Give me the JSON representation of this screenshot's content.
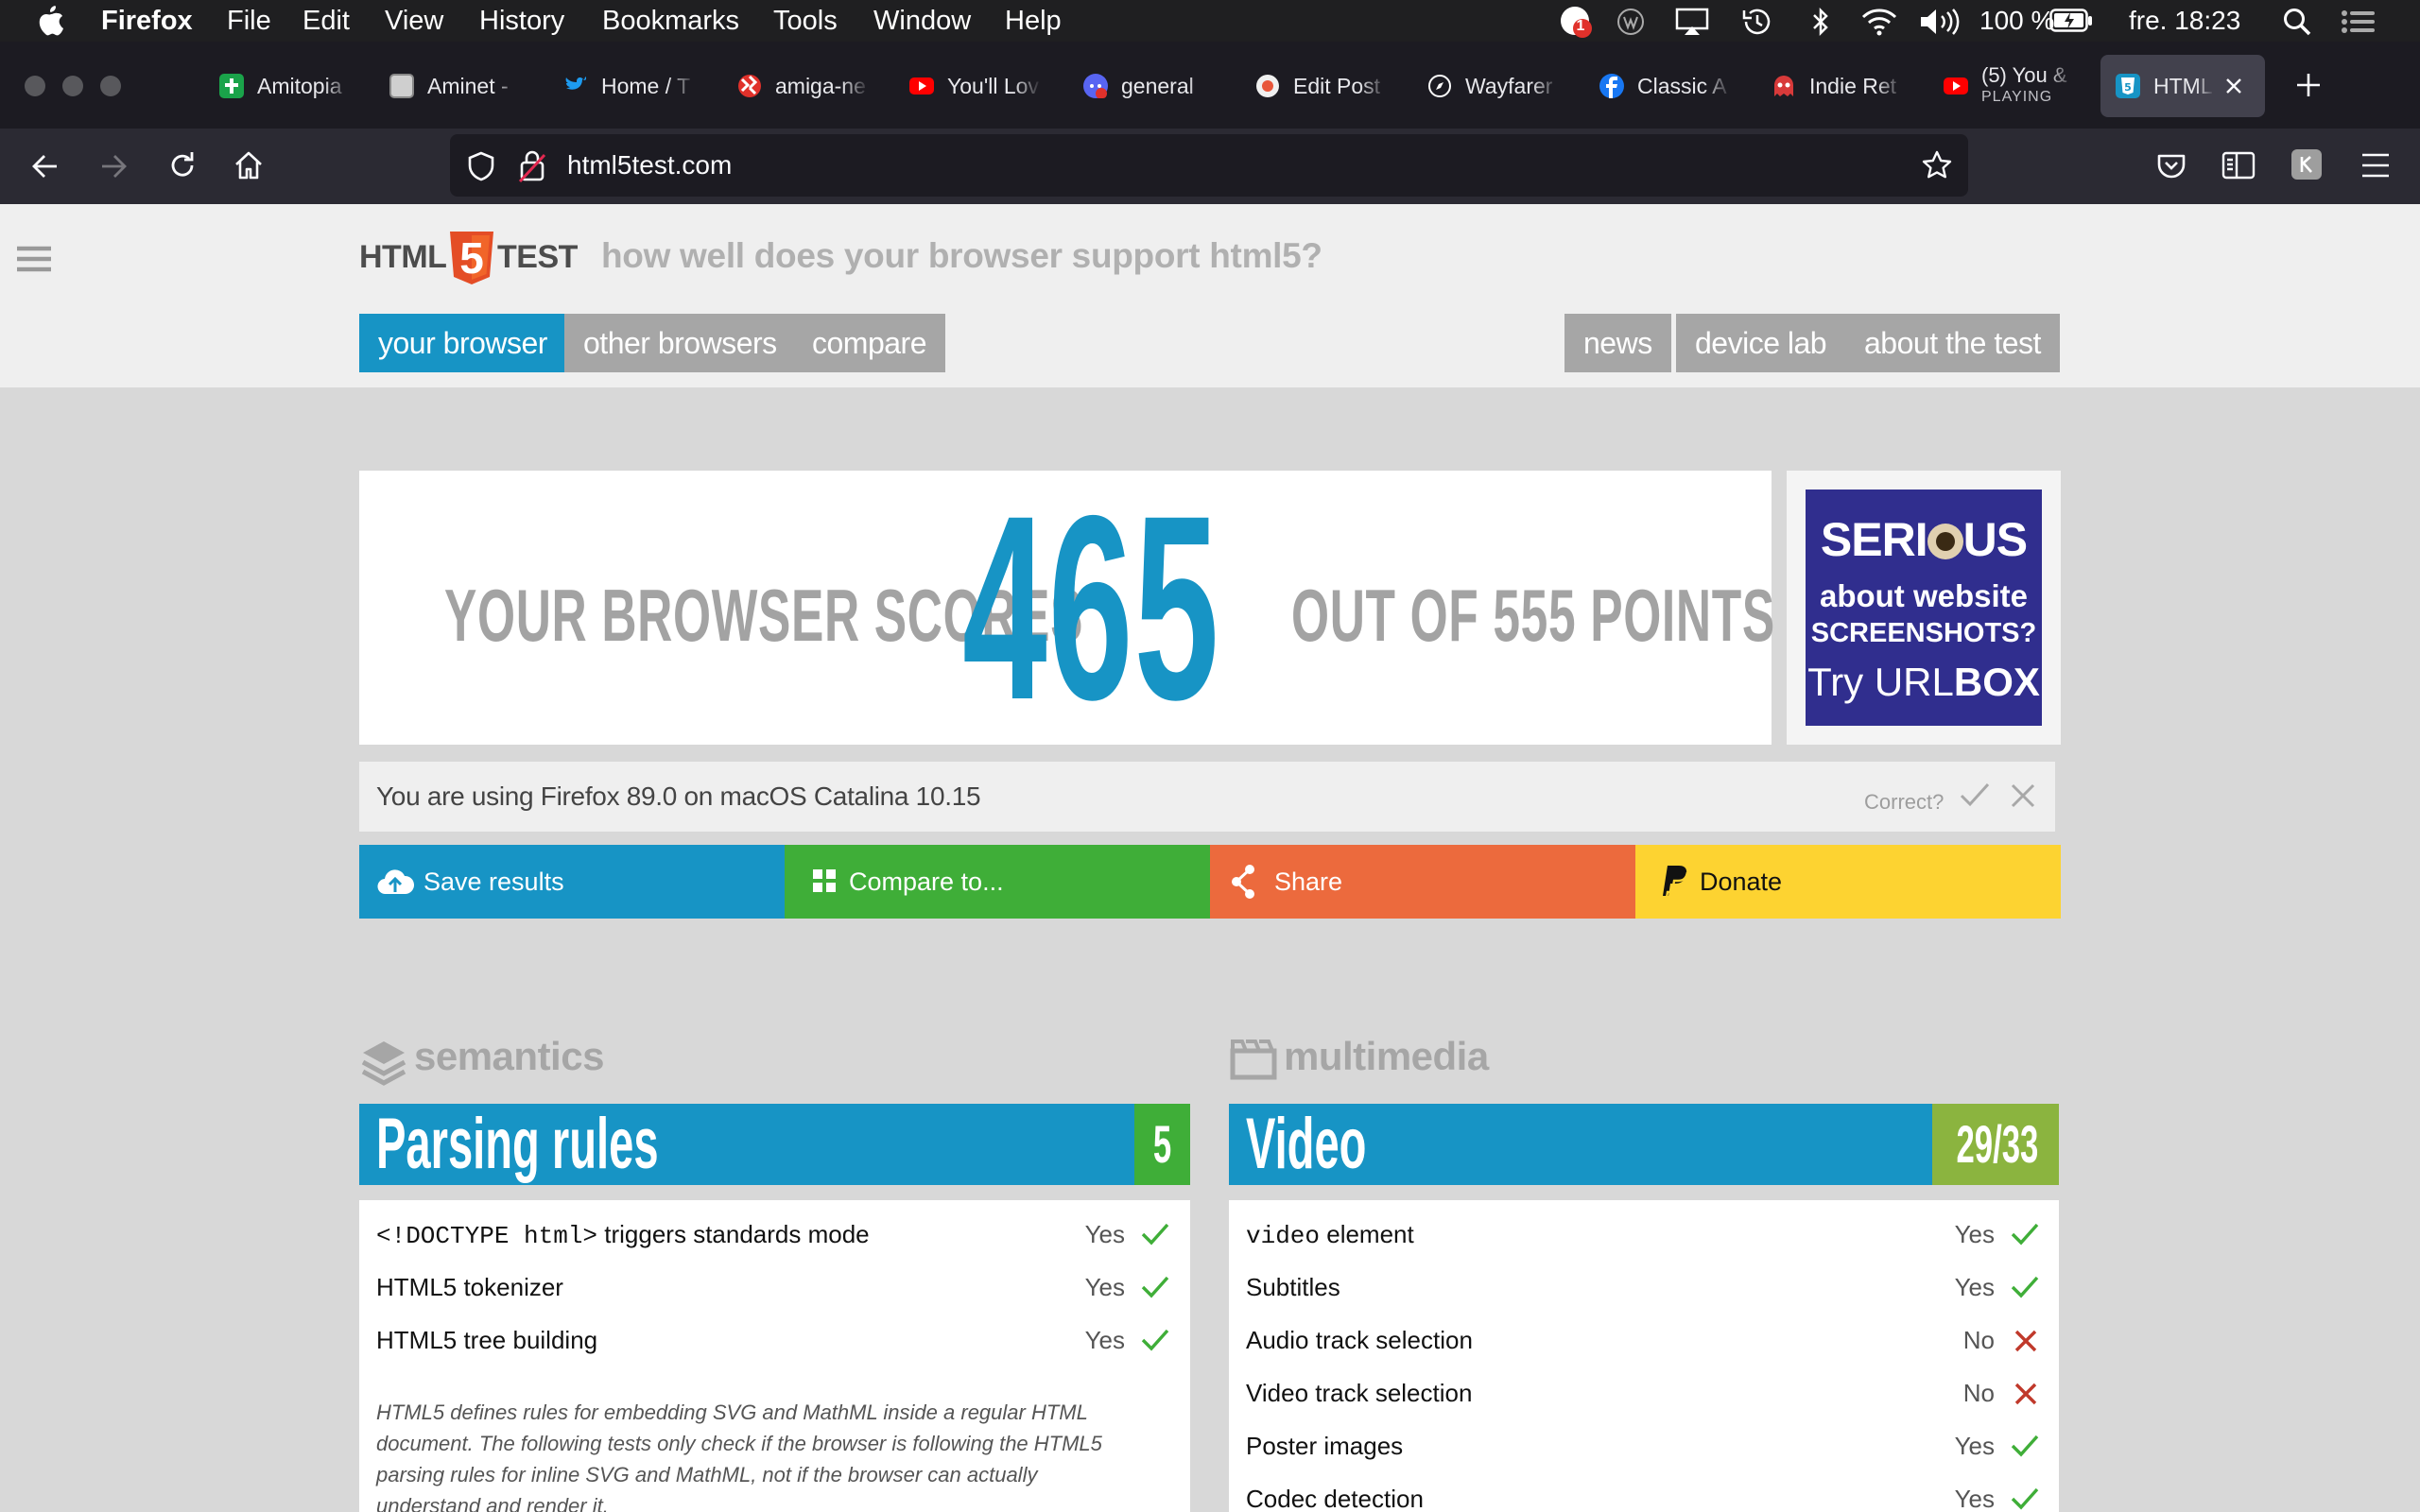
{
  "menubar": {
    "app": "Firefox",
    "items": [
      "File",
      "Edit",
      "View",
      "History",
      "Bookmarks",
      "Tools",
      "Window",
      "Help"
    ],
    "badge": "1",
    "battery": "100 %",
    "clock": "fre. 18:23"
  },
  "tabs": [
    {
      "label": "Amitopia",
      "color": "#1aa34a"
    },
    {
      "label": "Aminet -",
      "color": "#dddddd"
    },
    {
      "label": "Home / T",
      "color": "#1d9bf0"
    },
    {
      "label": "amiga-ne",
      "color": "#e0312b"
    },
    {
      "label": "You'll Lov",
      "color": "#ff0000"
    },
    {
      "label": "general",
      "color": "#5865f2"
    },
    {
      "label": "Edit Post",
      "color": "#f0f0f0"
    },
    {
      "label": "Wayfarer",
      "color": "#ffffff"
    },
    {
      "label": "Classic A",
      "color": "#1877f2"
    },
    {
      "label": "Indie Ret",
      "color": "#d83a3a"
    },
    {
      "label": "(5) You &",
      "sub": "PLAYING",
      "color": "#ff0000"
    },
    {
      "label": "HTML5",
      "color": "#1794c5"
    }
  ],
  "urlbar": {
    "url": "html5test.com"
  },
  "site": {
    "logo_left": "HTML",
    "logo_num": "5",
    "logo_right": "TEST",
    "tagline": "how well does your browser support html5?",
    "nav_left": [
      "your browser",
      "other browsers",
      "compare"
    ],
    "nav_right": [
      "news",
      "device lab",
      "about the test"
    ]
  },
  "score": {
    "prefix": "YOUR BROWSER SCORES",
    "value": "465",
    "suffix": "OUT OF 555 POINTS"
  },
  "ad": {
    "l1a": "SERI",
    "l1b": "US",
    "l2": "about website",
    "l3": "SCREENSHOTS?",
    "l4a": "Try URL",
    "l4b": "BOX"
  },
  "ua": {
    "text": "You are using Firefox 89.0 on macOS Catalina 10.15",
    "correct": "Correct?"
  },
  "actions": [
    {
      "label": "Save results",
      "color": "#1794c5"
    },
    {
      "label": "Compare to...",
      "color": "#3fae38"
    },
    {
      "label": "Share",
      "color": "#ec6a3d"
    },
    {
      "label": "Donate",
      "color": "#fdd331"
    }
  ],
  "sections": {
    "semantics": {
      "title": "semantics",
      "category": "Parsing rules",
      "score": "5",
      "rows": [
        {
          "code": "<!DOCTYPE html>",
          "label": " triggers standards mode",
          "result": "Yes"
        },
        {
          "label": "HTML5 tokenizer",
          "result": "Yes"
        },
        {
          "label": "HTML5 tree building",
          "result": "Yes"
        }
      ],
      "note": "HTML5 defines rules for embedding SVG and MathML inside a regular HTML document. The following tests only check if the browser is following the HTML5 parsing rules for inline SVG and MathML, not if the browser can actually understand and render it."
    },
    "multimedia": {
      "title": "multimedia",
      "category": "Video",
      "score": "29/33",
      "rows": [
        {
          "code": "video",
          "label": " element",
          "result": "Yes"
        },
        {
          "label": "Subtitles",
          "result": "Yes"
        },
        {
          "label": "Audio track selection",
          "result": "No"
        },
        {
          "label": "Video track selection",
          "result": "No"
        },
        {
          "label": "Poster images",
          "result": "Yes"
        },
        {
          "label": "Codec detection",
          "result": "Yes"
        }
      ]
    }
  }
}
